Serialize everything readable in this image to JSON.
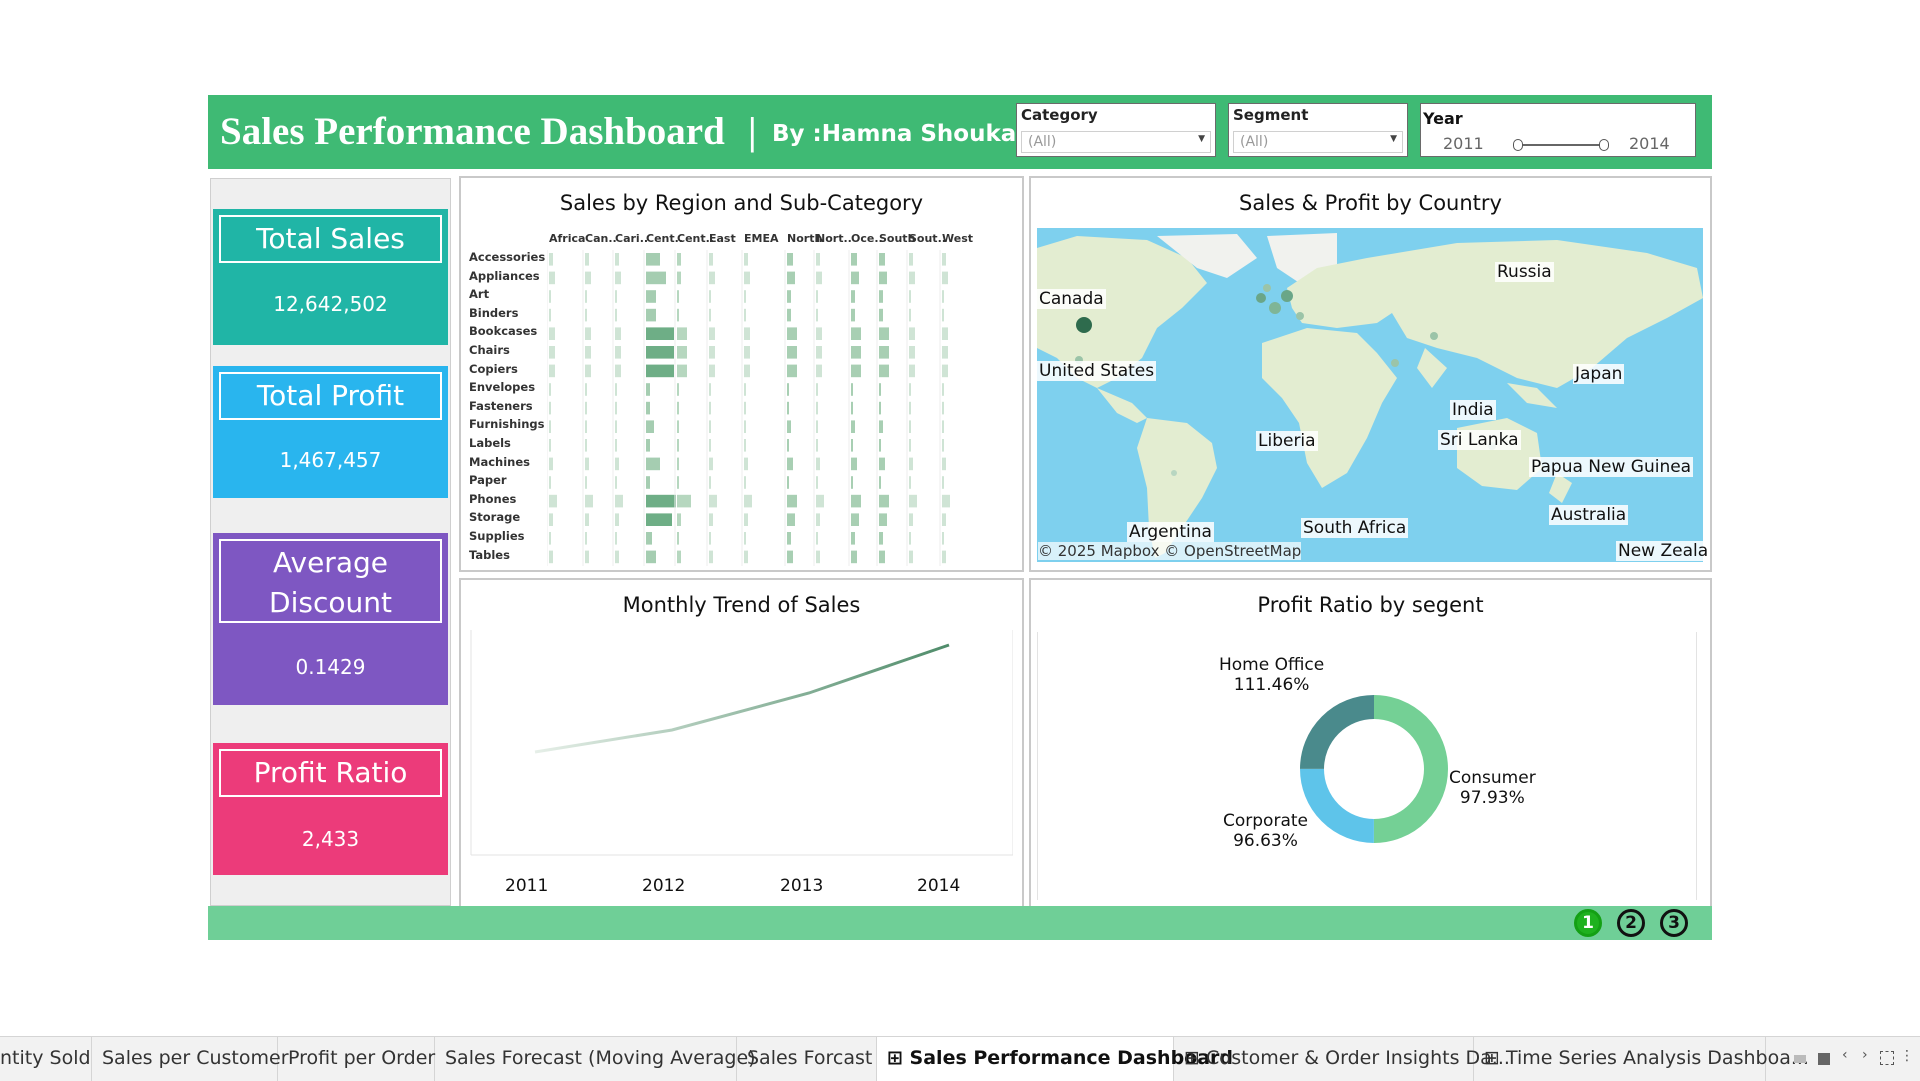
{
  "header": {
    "title": "Sales Performance Dashboard",
    "separator": "|",
    "author": "By :Hamna Shoukat",
    "filters": {
      "category": {
        "label": "Category",
        "value": "(All)"
      },
      "segment": {
        "label": "Segment",
        "value": "(All)"
      },
      "year": {
        "label": "Year",
        "min": "2011",
        "max": "2014"
      }
    }
  },
  "kpis": [
    {
      "title": "Total Sales",
      "value": "12,642,502",
      "color": "#20b5a6"
    },
    {
      "title": "Total Profit",
      "value": "1,467,457",
      "color": "#29b5ee"
    },
    {
      "title": "Average Discount",
      "value": "0.1429",
      "color": "#7e57c2"
    },
    {
      "title": "Profit Ratio",
      "value": "2,433",
      "color": "#ec3b7a"
    }
  ],
  "heatmap": {
    "title": "Sales by Region and Sub-Category",
    "columns": [
      "Africa",
      "Can..",
      "Cari..",
      "Cent..",
      "Cent..",
      "East",
      "EMEA",
      "North",
      "Nort..",
      "Oce..",
      "South",
      "Sout..",
      "West"
    ],
    "rows": [
      "Accessories",
      "Appliances",
      "Art",
      "Binders",
      "Bookcases",
      "Chairs",
      "Copiers",
      "Envelopes",
      "Fasteners",
      "Furnishings",
      "Labels",
      "Machines",
      "Paper",
      "Phones",
      "Storage",
      "Supplies",
      "Tables"
    ]
  },
  "map": {
    "title": "Sales & Profit by Country",
    "labels": [
      "Canada",
      "Russia",
      "United States",
      "Japan",
      "India",
      "Liberia",
      "Sri Lanka",
      "Papua New Guinea",
      "Australia",
      "Argentina",
      "South Africa",
      "New Zeala"
    ],
    "attribution": "© 2025 Mapbox © OpenStreetMap"
  },
  "trend": {
    "title": "Monthly Trend of Sales",
    "x_labels": [
      "2011",
      "2012",
      "2013",
      "2014"
    ]
  },
  "donut": {
    "title": "Profit Ratio by segent",
    "segments": [
      {
        "name": "Home Office",
        "pct": "111.46%",
        "color": "#4a8a8c"
      },
      {
        "name": "Consumer",
        "pct": "97.93%",
        "color": "#74d095"
      },
      {
        "name": "Corporate",
        "pct": "96.63%",
        "color": "#5ec4ea"
      }
    ]
  },
  "pager": [
    "1",
    "2",
    "3"
  ],
  "tabs": [
    {
      "label": "ntity Sold"
    },
    {
      "label": "Sales per Customer"
    },
    {
      "label": "Profit per Order"
    },
    {
      "label": "Sales Forecast (Moving Average)"
    },
    {
      "label": "Sales Forcast"
    },
    {
      "label": "Sales Performance Dashboard",
      "icon": "⊞"
    },
    {
      "label": "Customer & Order Insights Da...",
      "icon": "⊞"
    },
    {
      "label": "Time Series Analysis Dashboa...",
      "icon": "⊞"
    }
  ]
}
